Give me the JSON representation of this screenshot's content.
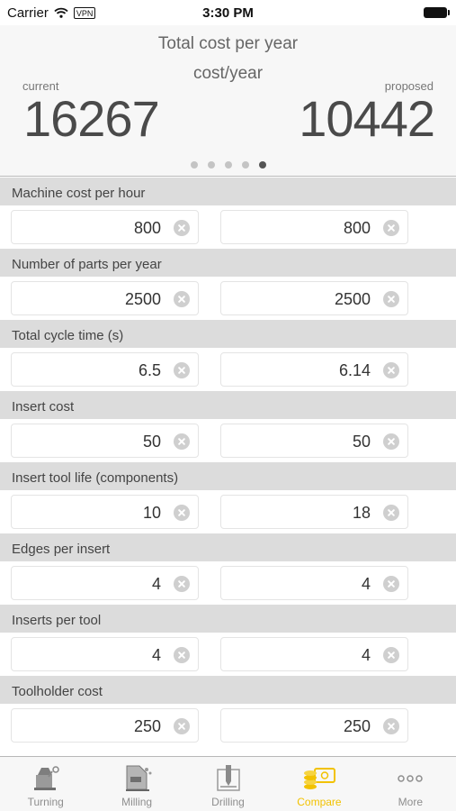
{
  "status_bar": {
    "carrier": "Carrier",
    "vpn": "VPN",
    "time": "3:30 PM"
  },
  "header": {
    "title": "Total cost per year",
    "subtitle": "cost/year",
    "current_caption": "current",
    "proposed_caption": "proposed",
    "current_value": "16267",
    "proposed_value": "10442",
    "pages": 5,
    "active_page": 5
  },
  "fields": [
    {
      "label": "Machine cost per hour",
      "current": "800",
      "proposed": "800"
    },
    {
      "label": "Number of parts per year",
      "current": "2500",
      "proposed": "2500"
    },
    {
      "label": "Total cycle time (s)",
      "current": "6.5",
      "proposed": "6.14"
    },
    {
      "label": "Insert cost",
      "current": "50",
      "proposed": "50"
    },
    {
      "label": "Insert tool life (components)",
      "current": "10",
      "proposed": "18"
    },
    {
      "label": "Edges per insert",
      "current": "4",
      "proposed": "4"
    },
    {
      "label": "Inserts per tool",
      "current": "4",
      "proposed": "4"
    },
    {
      "label": "Toolholder cost",
      "current": "250",
      "proposed": "250"
    }
  ],
  "tab_bar": {
    "active_color": "#f2c200",
    "tabs": [
      {
        "label": "Turning",
        "icon": "lathe-icon"
      },
      {
        "label": "Milling",
        "icon": "milling-machine-icon"
      },
      {
        "label": "Drilling",
        "icon": "drill-icon"
      },
      {
        "label": "Compare",
        "icon": "coins-cash-icon",
        "active": true
      },
      {
        "label": "More",
        "icon": "more-dots-icon"
      }
    ]
  }
}
